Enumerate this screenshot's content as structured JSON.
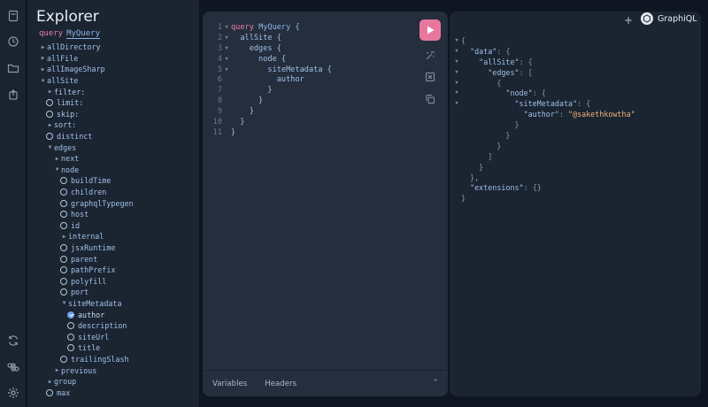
{
  "explorer": {
    "title": "Explorer",
    "query_keyword": "query",
    "query_name": "MyQuery",
    "rows": [
      {
        "label": "allDirectory",
        "indent": 0,
        "kind": "caret-right"
      },
      {
        "label": "allFile",
        "indent": 0,
        "kind": "caret-right"
      },
      {
        "label": "allImageSharp",
        "indent": 0,
        "kind": "caret-right"
      },
      {
        "label": "allSite",
        "indent": 0,
        "kind": "caret-down"
      },
      {
        "label": "filter:",
        "indent": 1,
        "kind": "caret-right"
      },
      {
        "label": "limit:",
        "indent": 1,
        "kind": "circle"
      },
      {
        "label": "skip:",
        "indent": 1,
        "kind": "circle"
      },
      {
        "label": "sort:",
        "indent": 1,
        "kind": "caret-right"
      },
      {
        "label": "distinct",
        "indent": 1,
        "kind": "circle"
      },
      {
        "label": "edges",
        "indent": 1,
        "kind": "caret-down"
      },
      {
        "label": "next",
        "indent": 2,
        "kind": "caret-right"
      },
      {
        "label": "node",
        "indent": 2,
        "kind": "caret-down"
      },
      {
        "label": "buildTime",
        "indent": 3,
        "kind": "circle"
      },
      {
        "label": "children",
        "indent": 3,
        "kind": "circle"
      },
      {
        "label": "graphqlTypegen",
        "indent": 3,
        "kind": "circle"
      },
      {
        "label": "host",
        "indent": 3,
        "kind": "circle"
      },
      {
        "label": "id",
        "indent": 3,
        "kind": "circle"
      },
      {
        "label": "internal",
        "indent": 3,
        "kind": "caret-right"
      },
      {
        "label": "jsxRuntime",
        "indent": 3,
        "kind": "circle"
      },
      {
        "label": "parent",
        "indent": 3,
        "kind": "circle"
      },
      {
        "label": "pathPrefix",
        "indent": 3,
        "kind": "circle"
      },
      {
        "label": "polyfill",
        "indent": 3,
        "kind": "circle"
      },
      {
        "label": "port",
        "indent": 3,
        "kind": "circle"
      },
      {
        "label": "siteMetadata",
        "indent": 3,
        "kind": "caret-down"
      },
      {
        "label": "author",
        "indent": 4,
        "kind": "checked"
      },
      {
        "label": "description",
        "indent": 4,
        "kind": "circle"
      },
      {
        "label": "siteUrl",
        "indent": 4,
        "kind": "circle"
      },
      {
        "label": "title",
        "indent": 4,
        "kind": "circle"
      },
      {
        "label": "trailingSlash",
        "indent": 3,
        "kind": "circle"
      },
      {
        "label": "previous",
        "indent": 2,
        "kind": "caret-right"
      },
      {
        "label": "group",
        "indent": 1,
        "kind": "caret-right"
      },
      {
        "label": "max",
        "indent": 1,
        "kind": "circle"
      }
    ]
  },
  "editor": {
    "lines": [
      {
        "num": "1",
        "fold": true,
        "indent": "",
        "keyword": "query",
        "name": "MyQuery",
        "text": " {"
      },
      {
        "num": "2",
        "fold": true,
        "indent": "  ",
        "text": "allSite {"
      },
      {
        "num": "3",
        "fold": true,
        "indent": "    ",
        "text": "edges {"
      },
      {
        "num": "4",
        "fold": true,
        "indent": "      ",
        "text": "node {"
      },
      {
        "num": "5",
        "fold": true,
        "indent": "        ",
        "text": "siteMetadata {"
      },
      {
        "num": "6",
        "fold": false,
        "indent": "          ",
        "text": "author"
      },
      {
        "num": "7",
        "fold": false,
        "indent": "        ",
        "text": "}"
      },
      {
        "num": "8",
        "fold": false,
        "indent": "      ",
        "text": "}"
      },
      {
        "num": "9",
        "fold": false,
        "indent": "    ",
        "text": "}"
      },
      {
        "num": "10",
        "fold": false,
        "indent": "  ",
        "text": "}"
      },
      {
        "num": "11",
        "fold": false,
        "indent": "",
        "text": "}"
      }
    ],
    "tabs": {
      "variables": "Variables",
      "headers": "Headers"
    }
  },
  "result": {
    "lines": [
      {
        "fold": true,
        "parts": [
          {
            "t": "{",
            "c": "punct"
          }
        ]
      },
      {
        "fold": true,
        "parts": [
          {
            "t": "  ",
            "c": "punct"
          },
          {
            "t": "\"data\"",
            "c": "key"
          },
          {
            "t": ": {",
            "c": "punct"
          }
        ]
      },
      {
        "fold": true,
        "parts": [
          {
            "t": "    ",
            "c": "punct"
          },
          {
            "t": "\"allSite\"",
            "c": "key"
          },
          {
            "t": ": {",
            "c": "punct"
          }
        ]
      },
      {
        "fold": true,
        "parts": [
          {
            "t": "      ",
            "c": "punct"
          },
          {
            "t": "\"edges\"",
            "c": "key"
          },
          {
            "t": ": [",
            "c": "punct"
          }
        ]
      },
      {
        "fold": true,
        "parts": [
          {
            "t": "        {",
            "c": "punct"
          }
        ]
      },
      {
        "fold": true,
        "parts": [
          {
            "t": "          ",
            "c": "punct"
          },
          {
            "t": "\"node\"",
            "c": "key"
          },
          {
            "t": ": {",
            "c": "punct"
          }
        ]
      },
      {
        "fold": true,
        "parts": [
          {
            "t": "            ",
            "c": "punct"
          },
          {
            "t": "\"siteMetadata\"",
            "c": "key"
          },
          {
            "t": ": {",
            "c": "punct"
          }
        ]
      },
      {
        "fold": false,
        "parts": [
          {
            "t": "              ",
            "c": "punct"
          },
          {
            "t": "\"author\"",
            "c": "key"
          },
          {
            "t": ": ",
            "c": "punct"
          },
          {
            "t": "\"@sakethkowtha\"",
            "c": "str"
          }
        ]
      },
      {
        "fold": false,
        "parts": [
          {
            "t": "            }",
            "c": "punct"
          }
        ]
      },
      {
        "fold": false,
        "parts": [
          {
            "t": "          }",
            "c": "punct"
          }
        ]
      },
      {
        "fold": false,
        "parts": [
          {
            "t": "        }",
            "c": "punct"
          }
        ]
      },
      {
        "fold": false,
        "parts": [
          {
            "t": "      ]",
            "c": "punct"
          }
        ]
      },
      {
        "fold": false,
        "parts": [
          {
            "t": "    }",
            "c": "punct"
          }
        ]
      },
      {
        "fold": false,
        "parts": [
          {
            "t": "  },",
            "c": "punct"
          }
        ]
      },
      {
        "fold": false,
        "parts": [
          {
            "t": "  ",
            "c": "punct"
          },
          {
            "t": "\"extensions\"",
            "c": "key"
          },
          {
            "t": ": {}",
            "c": "punct"
          }
        ]
      },
      {
        "fold": false,
        "parts": [
          {
            "t": "}",
            "c": "punct"
          }
        ]
      }
    ]
  },
  "topbar": {
    "add_label": "+",
    "logo_text": "GraphiQL"
  },
  "colors": {
    "run_button": "#e8779e",
    "keyword": "#e97fa8",
    "field": "#9fc0e6",
    "string": "#f0b37a",
    "editor_bg": "#242e3d"
  }
}
